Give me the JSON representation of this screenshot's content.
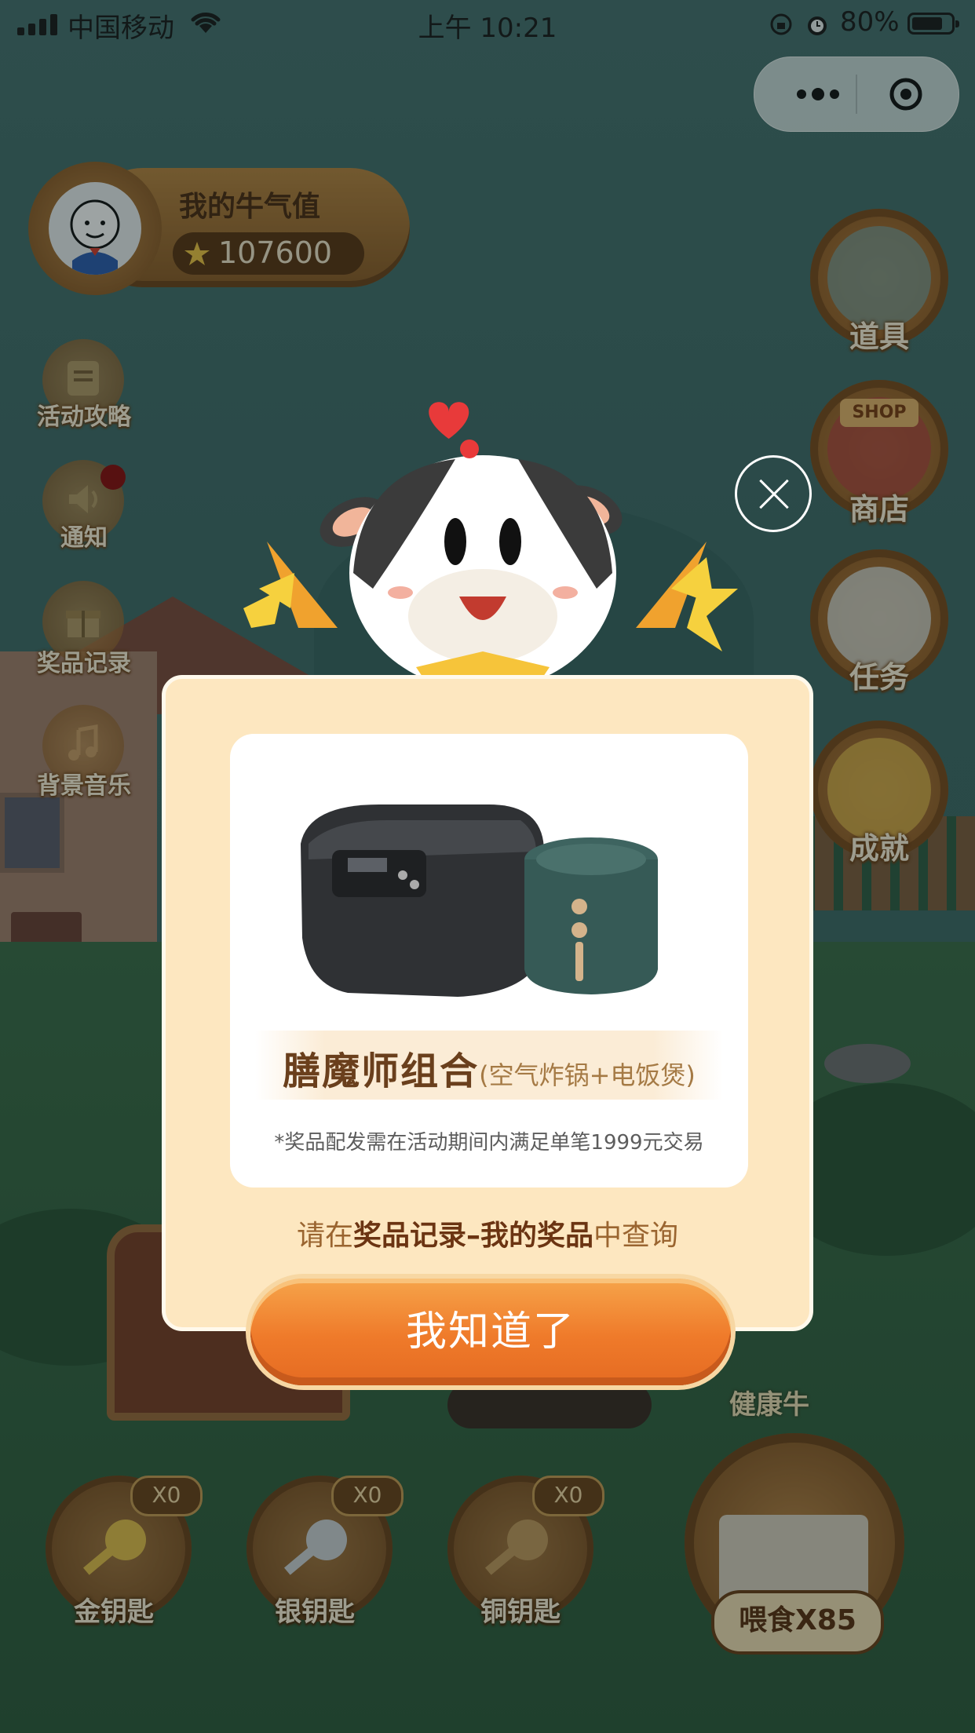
{
  "status_bar": {
    "carrier": "中国移动",
    "time": "上午 10:21",
    "battery_percent": "80%"
  },
  "capsule": {
    "more_icon": "more-dots-icon",
    "close_icon": "target-close-icon"
  },
  "profile": {
    "title": "我的牛气值",
    "score": "107600"
  },
  "left_menu": [
    {
      "label": "活动攻略",
      "icon": "guide-icon"
    },
    {
      "label": "通知",
      "icon": "speaker-icon",
      "has_dot": true
    },
    {
      "label": "奖品记录",
      "icon": "gift-icon"
    },
    {
      "label": "背景音乐",
      "icon": "music-note-icon"
    }
  ],
  "right_menu": [
    {
      "label": "道具",
      "icon": "watering-can-icon"
    },
    {
      "label": "商店",
      "icon": "shop-icon",
      "tag": "SHOP"
    },
    {
      "label": "任务",
      "icon": "clipboard-icon"
    },
    {
      "label": "成就",
      "icon": "badge-icon"
    }
  ],
  "keys": [
    {
      "label": "金钥匙",
      "count": "X0",
      "color": "#e6c04a"
    },
    {
      "label": "银钥匙",
      "count": "X0",
      "color": "#cfd2d6"
    },
    {
      "label": "铜钥匙",
      "count": "X0",
      "color": "#c49a5c"
    }
  ],
  "healthy_label": "健康牛",
  "feed_label": "喂食X85",
  "modal": {
    "prize_name": "膳魔师组合",
    "prize_detail": "(空气炸锅+电饭煲)",
    "prize_note": "*奖品配发需在活动期间内满足单笔1999元交易",
    "query_prefix": "请在",
    "query_bold": "奖品记录–我的奖品",
    "query_suffix": "中查询",
    "ok_label": "我知道了"
  },
  "colors": {
    "accent_orange": "#ef7a2a",
    "modal_bg": "#fde7c0",
    "wood_brown": "#9a632a"
  }
}
